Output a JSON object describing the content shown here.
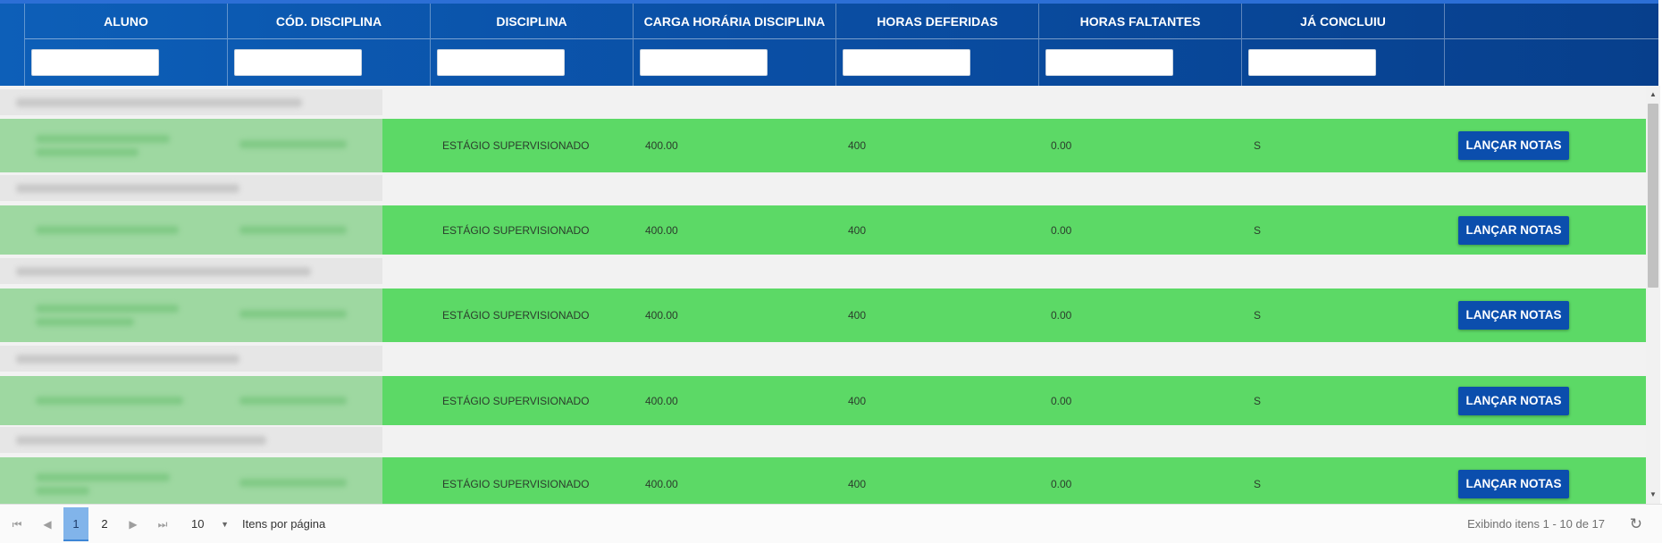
{
  "columns": [
    {
      "label": "ALUNO",
      "filter": ""
    },
    {
      "label": "CÓD. DISCIPLINA",
      "filter": ""
    },
    {
      "label": "DISCIPLINA",
      "filter": ""
    },
    {
      "label": "CARGA HORÁRIA DISCIPLINA",
      "filter": ""
    },
    {
      "label": "HORAS DEFERIDAS",
      "filter": ""
    },
    {
      "label": "HORAS FALTANTES",
      "filter": ""
    },
    {
      "label": "JÁ CONCLUIU",
      "filter": ""
    },
    {
      "label": "",
      "filter": null
    }
  ],
  "rows": [
    {
      "disciplina": "ESTÁGIO SUPERVISIONADO",
      "carga": "400.00",
      "deferidas": "400",
      "faltantes": "0.00",
      "concluiu": "S",
      "action": "LANÇAR NOTAS"
    },
    {
      "disciplina": "ESTÁGIO SUPERVISIONADO",
      "carga": "400.00",
      "deferidas": "400",
      "faltantes": "0.00",
      "concluiu": "S",
      "action": "LANÇAR NOTAS"
    },
    {
      "disciplina": "ESTÁGIO SUPERVISIONADO",
      "carga": "400.00",
      "deferidas": "400",
      "faltantes": "0.00",
      "concluiu": "S",
      "action": "LANÇAR NOTAS"
    },
    {
      "disciplina": "ESTÁGIO SUPERVISIONADO",
      "carga": "400.00",
      "deferidas": "400",
      "faltantes": "0.00",
      "concluiu": "S",
      "action": "LANÇAR NOTAS"
    },
    {
      "disciplina": "ESTÁGIO SUPERVISIONADO",
      "carga": "400.00",
      "deferidas": "400",
      "faltantes": "0.00",
      "concluiu": "S",
      "action": "LANÇAR NOTAS"
    }
  ],
  "pager": {
    "pages": [
      "1",
      "2"
    ],
    "current_page": "1",
    "page_size": "10",
    "page_size_label": "Itens por página",
    "info": "Exibindo itens 1 - 10 de 17",
    "first_icon": "first-page-icon",
    "prev_icon": "previous-page-icon",
    "next_icon": "next-page-icon",
    "last_icon": "last-page-icon",
    "refresh_icon": "refresh-icon"
  },
  "colors": {
    "header": "#0a4fa5",
    "row_success": "#5cd966",
    "button": "#0b4ead",
    "group_row": "#e6e6e6"
  }
}
